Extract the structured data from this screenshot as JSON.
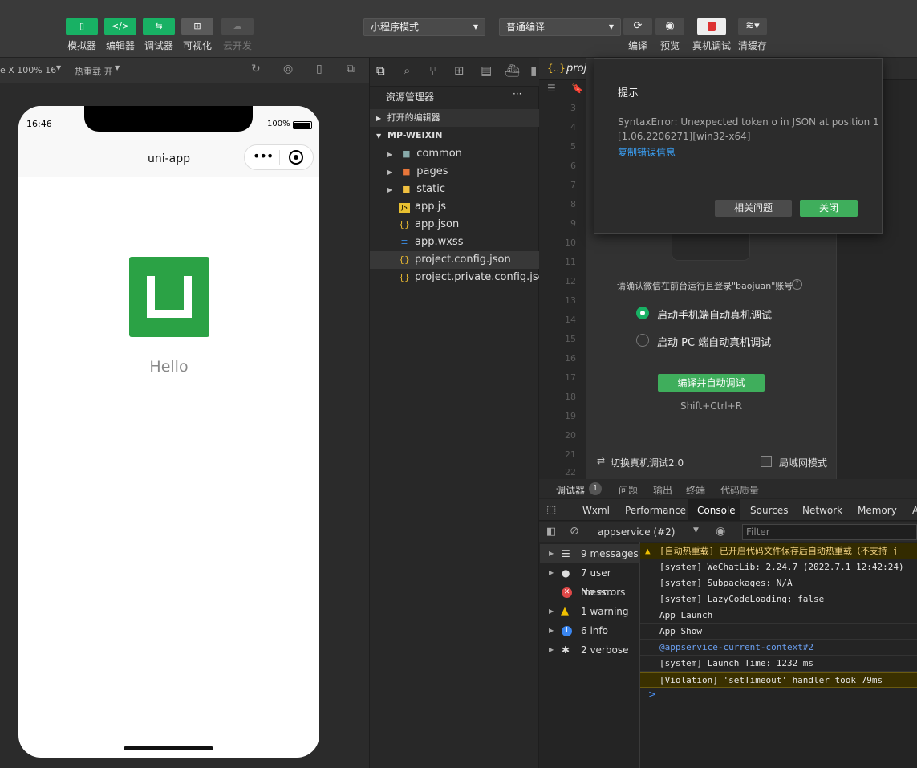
{
  "toolbar": {
    "left_buttons": [
      {
        "label": "模拟器",
        "icon": "phone-icon"
      },
      {
        "label": "编辑器",
        "icon": "code-icon"
      },
      {
        "label": "调试器",
        "icon": "debug-icon"
      },
      {
        "label": "可视化",
        "icon": "layout-icon"
      },
      {
        "label": "云开发",
        "icon": "cloud-icon"
      }
    ],
    "mode_select": "小程序模式",
    "compile_select": "普通编译",
    "right_buttons": [
      {
        "label": "编译",
        "icon": "refresh-icon"
      },
      {
        "label": "预览",
        "icon": "eye-icon"
      },
      {
        "label": "真机调试",
        "icon": "device-debug-icon"
      },
      {
        "label": "清缓存",
        "icon": "layers-icon"
      }
    ]
  },
  "simulator": {
    "device": "e X 100% 16",
    "hot_reload": "热重载 开",
    "time": "16:46",
    "battery": "100%",
    "nav_title": "uni-app",
    "hello": "Hello"
  },
  "explorer": {
    "title": "资源管理器",
    "more": "···",
    "open_editors": "打开的编辑器",
    "project": "MP-WEIXIN",
    "items": [
      {
        "name": "common",
        "type": "folder"
      },
      {
        "name": "pages",
        "type": "folder-pages"
      },
      {
        "name": "static",
        "type": "folder-static"
      },
      {
        "name": "app.js",
        "type": "js"
      },
      {
        "name": "app.json",
        "type": "json"
      },
      {
        "name": "app.wxss",
        "type": "wxss"
      },
      {
        "name": "project.config.json",
        "type": "json"
      },
      {
        "name": "project.private.config.json",
        "type": "json"
      }
    ]
  },
  "editor": {
    "tab": "proj",
    "line_numbers": [
      "3",
      "4",
      "5",
      "6",
      "7",
      "8",
      "9",
      "10",
      "11",
      "12",
      "13",
      "14",
      "15",
      "16",
      "17",
      "18",
      "19",
      "20",
      "21",
      "22"
    ]
  },
  "dialog": {
    "title": "提示",
    "message": "SyntaxError: Unexpected token o in JSON at position 1",
    "version": "[1.06.2206271][win32-x64]",
    "copy_link": "复制错误信息",
    "related_button": "相关问题",
    "close_button": "关闭"
  },
  "real_debug": {
    "confirm_text": "请确认微信在前台运行且登录\"baojuan\"账号",
    "option1": "启动手机端自动真机调试",
    "option2": "启动 PC 端自动真机调试",
    "compile_button": "编译并自动调试",
    "shortcut": "Shift+Ctrl+R",
    "switch_label": "切换真机调试2.0",
    "lan_mode": "局域网模式"
  },
  "debugger": {
    "top_tabs": [
      "调试器",
      "问题",
      "输出",
      "终端",
      "代码质量"
    ],
    "badge": "1",
    "devtools_tabs": [
      "Wxml",
      "Performance",
      "Console",
      "Sources",
      "Network",
      "Memory",
      "A"
    ],
    "context": "appservice (#2)",
    "filter_placeholder": "Filter",
    "sidebar": [
      {
        "label": "9 messages",
        "icon": "list-icon",
        "color": "#cccccc"
      },
      {
        "label": "7 user mess...",
        "icon": "user-icon",
        "color": "#cccccc"
      },
      {
        "label": "No errors",
        "icon": "error-icon",
        "color": "#e04848"
      },
      {
        "label": "1 warning",
        "icon": "warning-icon",
        "color": "#f0c000"
      },
      {
        "label": "6 info",
        "icon": "info-icon",
        "color": "#3a86f0"
      },
      {
        "label": "2 verbose",
        "icon": "bug-icon",
        "color": "#cccccc"
      }
    ],
    "messages": [
      {
        "text": "[自动热重载] 已开启代码文件保存后自动热重载（不支持 j",
        "kind": "warning"
      },
      {
        "text": "[system] WeChatLib: 2.24.7 (2022.7.1 12:42:24)",
        "kind": "log"
      },
      {
        "text": "[system] Subpackages: N/A",
        "kind": "log"
      },
      {
        "text": "[system] LazyCodeLoading: false",
        "kind": "log"
      },
      {
        "text": "App Launch",
        "kind": "log"
      },
      {
        "text": "App Show",
        "kind": "log"
      },
      {
        "text": "@appservice-current-context#2",
        "kind": "link"
      },
      {
        "text": "[system] Launch Time: 1232 ms",
        "kind": "log"
      },
      {
        "text": "[Violation] 'setTimeout' handler took 79ms",
        "kind": "violation"
      }
    ],
    "prompt": ">"
  }
}
